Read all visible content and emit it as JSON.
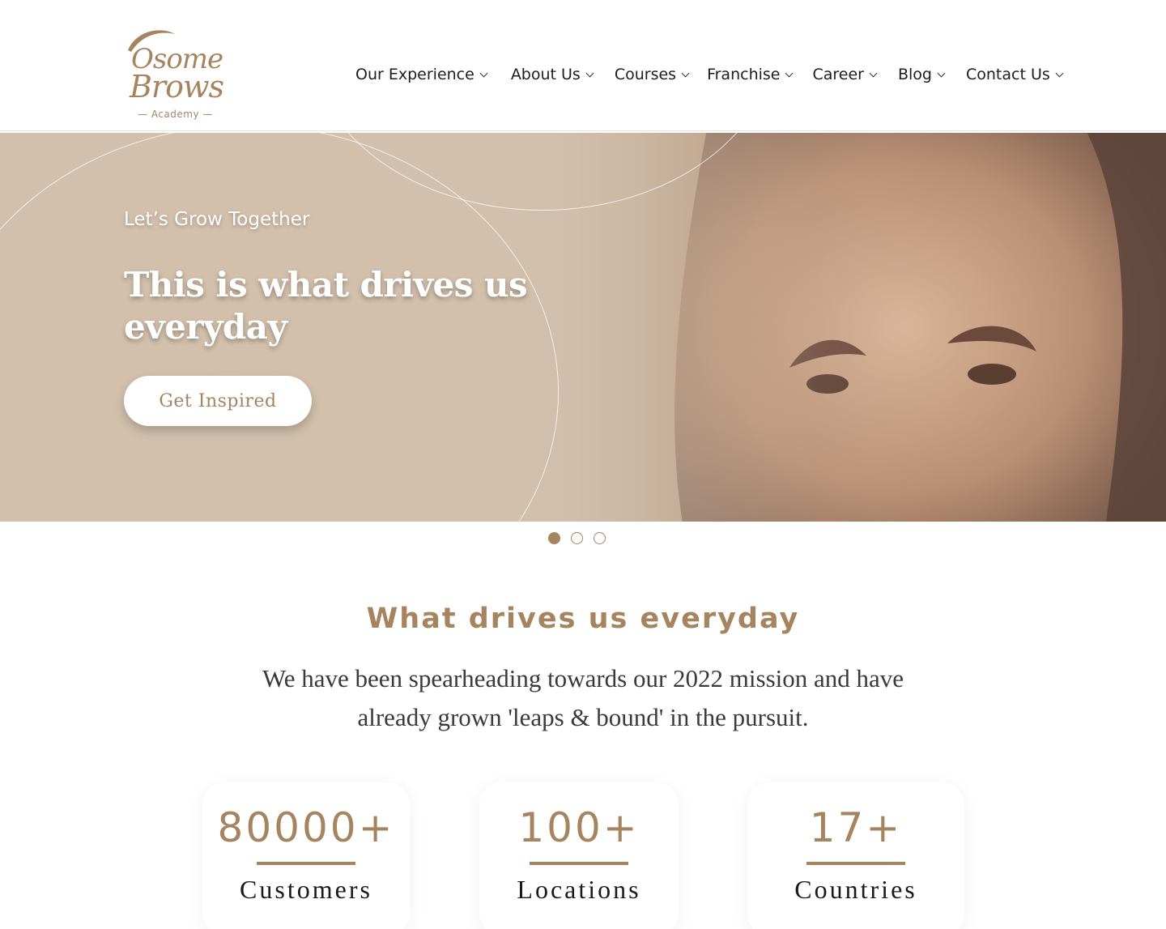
{
  "brand": {
    "logo_line1": "Osome",
    "logo_line2": "Brows",
    "logo_sub": "— Academy —",
    "color": "#a5845f"
  },
  "nav": {
    "items": [
      {
        "label": "Our Experience",
        "icon": "chevron-down-icon"
      },
      {
        "label": "About Us",
        "icon": "chevron-down-icon"
      },
      {
        "label": "Courses",
        "icon": "chevron-down-icon"
      },
      {
        "label": "Franchise",
        "icon": "chevron-down-icon"
      },
      {
        "label": "Career",
        "icon": "chevron-down-icon"
      },
      {
        "label": "Blog",
        "icon": "chevron-down-icon"
      },
      {
        "label": "Contact Us",
        "icon": "chevron-down-icon"
      }
    ]
  },
  "hero": {
    "eyebrow": "Let’s Grow Together",
    "title": "This is what drives us everyday",
    "button": "Get Inspired",
    "slides_total": 3,
    "active_slide": 1
  },
  "section": {
    "title": "What drives us everyday",
    "text": "We have been spearheading towards our 2022 mission and have already grown 'leaps & bound' in the pursuit."
  },
  "stats": [
    {
      "value": "80000+",
      "label": "Customers"
    },
    {
      "value": "100+",
      "label": "Locations"
    },
    {
      "value": "17+",
      "label": "Countries"
    }
  ]
}
